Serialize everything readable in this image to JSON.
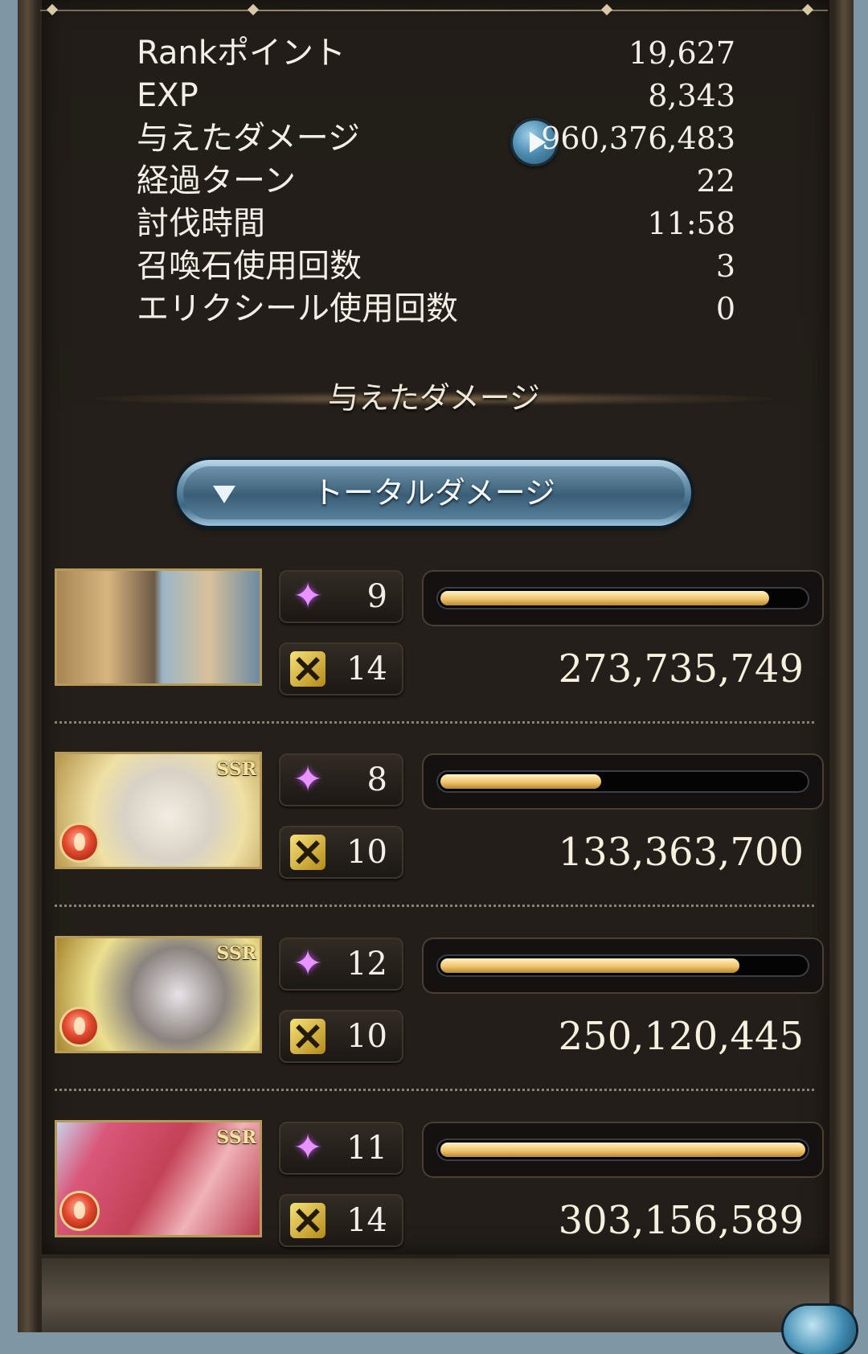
{
  "stats": [
    {
      "label": "Rankポイント",
      "value": "19,627"
    },
    {
      "label": "EXP",
      "value": "8,343"
    },
    {
      "label": "与えたダメージ",
      "value": "960,376,483"
    },
    {
      "label": "経過ターン",
      "value": "22"
    },
    {
      "label": "討伐時間",
      "value": "11:58"
    },
    {
      "label": "召喚石使用回数",
      "value": "3"
    },
    {
      "label": "エリクシール使用回数",
      "value": "0"
    }
  ],
  "section_title": "与えたダメージ",
  "dropdown": {
    "selected": "トータルダメージ"
  },
  "characters": [
    {
      "star_count": "9",
      "cross_count": "14",
      "damage": "273,735,749",
      "bar_fraction": 0.9,
      "ssr": "",
      "element": "",
      "art_colors": [
        "#c9a46a",
        "#5e8aa8"
      ]
    },
    {
      "star_count": "8",
      "cross_count": "10",
      "damage": "133,363,700",
      "bar_fraction": 0.44,
      "ssr": "SSR",
      "element": "fire",
      "art_colors": [
        "#efe1a6",
        "#d9d4cc"
      ]
    },
    {
      "star_count": "12",
      "cross_count": "10",
      "damage": "250,120,445",
      "bar_fraction": 0.82,
      "ssr": "SSR",
      "element": "fire",
      "art_colors": [
        "#e8d98a",
        "#76716c"
      ]
    },
    {
      "star_count": "11",
      "cross_count": "14",
      "damage": "303,156,589",
      "bar_fraction": 1.0,
      "ssr": "SSR",
      "element": "fire",
      "art_colors": [
        "#e394a8",
        "#c04a5e"
      ]
    }
  ],
  "icons": {
    "star": "star-icon",
    "cross": "crossed-swords-icon",
    "play": "play-icon",
    "dropdown": "chevron-down-icon"
  }
}
